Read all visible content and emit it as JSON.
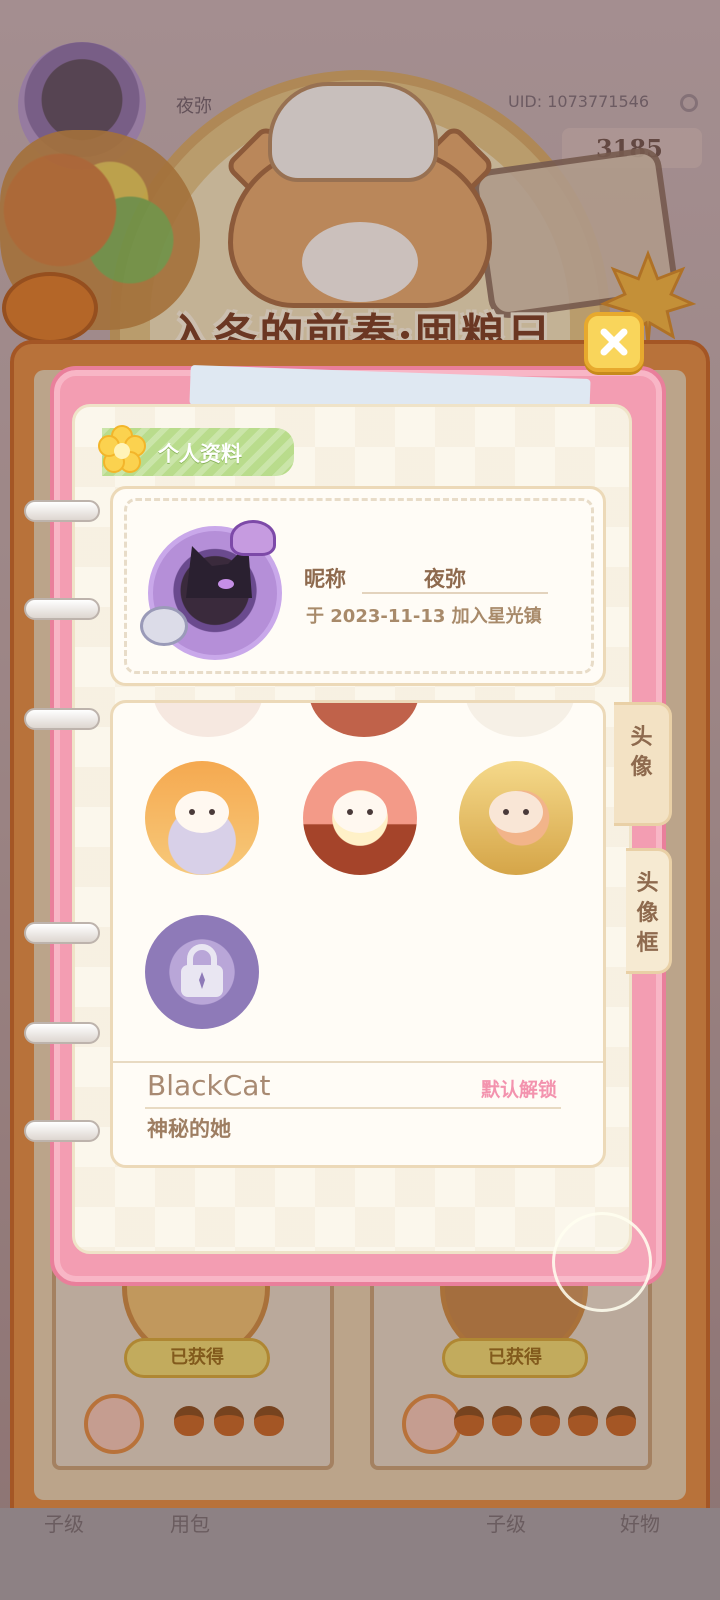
{
  "background": {
    "nickname_partial": "夜弥",
    "uid": "UID: 1073771546",
    "coins": "3185",
    "banner_title": "入冬的前奏·囤粮日",
    "cards": [
      {
        "status": "已获得",
        "acorns": 3
      },
      {
        "status": "已获得",
        "acorns": 5
      }
    ],
    "bottom_nav_left": "子级",
    "bottom_nav_mid": "用包",
    "bottom_nav_right1": "子级",
    "bottom_nav_right2": "好物"
  },
  "dialog": {
    "section_title": "个人资料",
    "profile": {
      "nickname_label": "昵称",
      "nickname": "夜弥",
      "joined": "于 2023-11-13 加入星光镇"
    },
    "tabs": [
      {
        "label": "头\n像",
        "selected": true
      },
      {
        "label": "头\n像\n框",
        "selected": false
      }
    ],
    "selected_item": {
      "name": "BlackCat",
      "unlock_method": "默认解锁",
      "description": "神秘的她"
    },
    "options": [
      {
        "name": "hamster-chestnut",
        "locked": false
      },
      {
        "name": "hamster-pudding",
        "locked": false
      },
      {
        "name": "hamster-chef",
        "locked": false
      },
      {
        "name": "locked-avatar",
        "locked": true
      }
    ]
  },
  "colors": {
    "dialog_pink": "#f39db2",
    "paper": "#fbf7ec",
    "tag_green": "#b9dc8c",
    "unlock_pink": "#f393ae",
    "close_yellow": "#f9d55b"
  }
}
